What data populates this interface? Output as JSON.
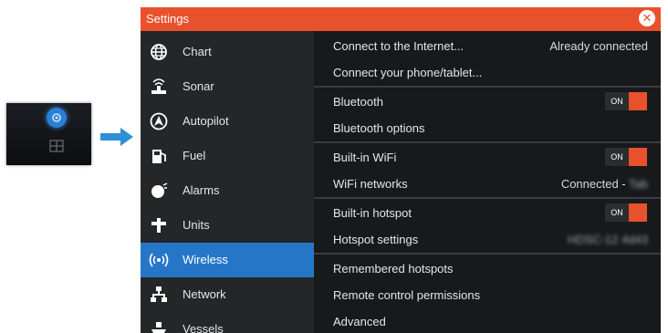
{
  "dialog": {
    "title": "Settings",
    "close_icon": "close-icon"
  },
  "sidebar": {
    "items": [
      {
        "label": "Chart",
        "icon": "globe-icon"
      },
      {
        "label": "Sonar",
        "icon": "sonar-icon"
      },
      {
        "label": "Autopilot",
        "icon": "autopilot-icon"
      },
      {
        "label": "Fuel",
        "icon": "fuel-icon"
      },
      {
        "label": "Alarms",
        "icon": "alarm-icon"
      },
      {
        "label": "Units",
        "icon": "units-icon"
      },
      {
        "label": "Wireless",
        "icon": "wireless-icon",
        "active": true
      },
      {
        "label": "Network",
        "icon": "network-icon"
      },
      {
        "label": "Vessels",
        "icon": "vessels-icon"
      }
    ]
  },
  "content": {
    "rows": [
      {
        "label": "Connect to the Internet...",
        "value": "Already connected"
      },
      {
        "label": "Connect your phone/tablet..."
      },
      {
        "label": "Bluetooth",
        "toggle": "ON"
      },
      {
        "label": "Bluetooth options"
      },
      {
        "label": "Built-in WiFi",
        "toggle": "ON"
      },
      {
        "label": "WiFi networks",
        "value": "Connected -",
        "value_blurred": "Tab"
      },
      {
        "label": "Built-in hotspot",
        "toggle": "ON"
      },
      {
        "label": "Hotspot settings",
        "value_blurred": "HDSC-12 4d43"
      },
      {
        "label": "Remembered hotspots"
      },
      {
        "label": "Remote control permissions"
      },
      {
        "label": "Advanced"
      }
    ]
  },
  "colors": {
    "accent": "#e8512b",
    "active": "#2676c8",
    "panel": "#1e1f21"
  }
}
